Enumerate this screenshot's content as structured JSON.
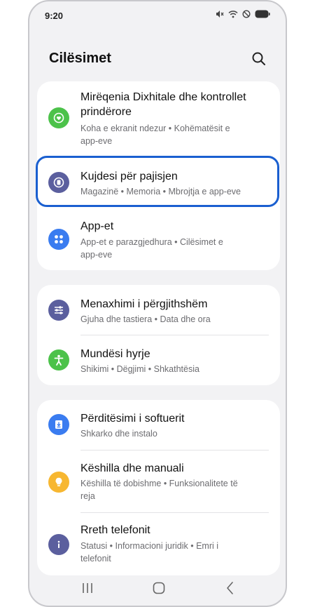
{
  "status_bar": {
    "time": "9:20",
    "icons": [
      "mute-icon",
      "wifi-icon",
      "no-disturb-icon",
      "battery-icon"
    ]
  },
  "header": {
    "title": "Cilësimet",
    "search_icon": "search-icon"
  },
  "groups": [
    {
      "items": [
        {
          "title_lines": [
            "Mirëqenia Dixhitale dhe kontrollet",
            "prindërore"
          ],
          "subtitle_lines": [
            "Koha e ekranit ndezur  •  Kohëmatësit e",
            "app-eve"
          ],
          "icon": "heart-icon",
          "color": "#4cc24a"
        },
        {
          "title_lines": [
            "Kujdesi për pajisjen"
          ],
          "subtitle_lines": [
            "Magazinë  •  Memoria  •  Mbrojtja e app-eve"
          ],
          "icon": "device-care-icon",
          "color": "#5b5f9e"
        },
        {
          "title_lines": [
            "App-et"
          ],
          "subtitle_lines": [
            "App-et e parazgjedhura  •  Cilësimet e",
            "app-eve"
          ],
          "icon": "apps-icon",
          "color": "#3a7cf0"
        }
      ]
    },
    {
      "items": [
        {
          "title_lines": [
            "Menaxhimi i përgjithshëm"
          ],
          "subtitle_lines": [
            "Gjuha dhe tastiera  •  Data dhe ora"
          ],
          "icon": "sliders-icon",
          "color": "#5b5f9e"
        },
        {
          "title_lines": [
            "Mundësi hyrje"
          ],
          "subtitle_lines": [
            "Shikimi  •  Dëgjimi  •  Shkathtësia"
          ],
          "icon": "accessibility-icon",
          "color": "#4cc24a"
        }
      ]
    },
    {
      "items": [
        {
          "title_lines": [
            "Përditësimi i softuerit"
          ],
          "subtitle_lines": [
            "Shkarko dhe instalo"
          ],
          "icon": "software-update-icon",
          "color": "#3a7cf0"
        },
        {
          "title_lines": [
            "Këshilla dhe manuali"
          ],
          "subtitle_lines": [
            "Këshilla të dobishme  •  Funksionalitete të",
            "reja"
          ],
          "icon": "lightbulb-icon",
          "color": "#f7b731"
        },
        {
          "title_lines": [
            "Rreth telefonit"
          ],
          "subtitle_lines": [
            "Statusi  •  Informacioni juridik  •  Emri i",
            "telefonit"
          ],
          "icon": "info-icon",
          "color": "#5b5f9e"
        }
      ]
    }
  ],
  "highlighted_item": "Kujdesi për pajisjen",
  "navbar": {
    "icons": [
      "recents-icon",
      "home-icon",
      "back-icon"
    ]
  }
}
